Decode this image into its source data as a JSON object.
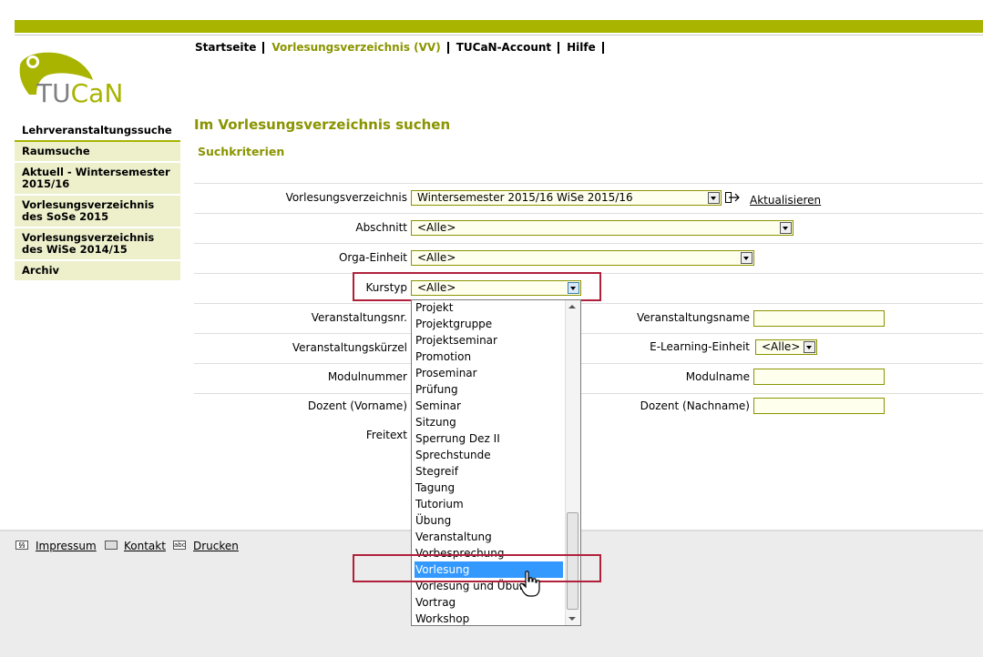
{
  "logo": {
    "text_a": "TU",
    "text_b": "CaN"
  },
  "nav": [
    {
      "label": "Startseite",
      "active": false
    },
    {
      "label": "Vorlesungsverzeichnis (VV)",
      "active": true
    },
    {
      "label": "TUCaN-Account",
      "active": false
    },
    {
      "label": "Hilfe",
      "active": false
    }
  ],
  "sidebar": [
    {
      "label": "Lehrveranstaltungssuche"
    },
    {
      "label": "Raumsuche"
    },
    {
      "label": "Aktuell - Wintersemester 2015/16"
    },
    {
      "label": "Vorlesungsverzeichnis des SoSe 2015"
    },
    {
      "label": "Vorlesungsverzeichnis des WiSe 2014/15"
    },
    {
      "label": "Archiv"
    }
  ],
  "page": {
    "title": "Im Vorlesungsverzeichnis suchen",
    "subtitle": "Suchkriterien"
  },
  "form": {
    "vv_label": "Vorlesungsverzeichnis",
    "vv_value": "Wintersemester 2015/16 WiSe 2015/16",
    "refresh_label": "Aktualisieren",
    "abschnitt_label": "Abschnitt",
    "abschnitt_value": "<Alle>",
    "orga_label": "Orga-Einheit",
    "orga_value": "<Alle>",
    "kurstyp_label": "Kurstyp",
    "kurstyp_value": "<Alle>",
    "vnr_label": "Veranstaltungsnr.",
    "vname_label": "Veranstaltungsname",
    "vkuerzel_label": "Veranstaltungskürzel",
    "elearning_label": "E-Learning-Einheit",
    "elearning_value": "<Alle>",
    "modulnr_label": "Modulnummer",
    "modulname_label": "Modulname",
    "dozent_vor_label": "Dozent (Vorname)",
    "dozent_nach_label": "Dozent (Nachname)",
    "freitext_label": "Freitext"
  },
  "dropdown": {
    "items": [
      "Projekt",
      "Projektgruppe",
      "Projektseminar",
      "Promotion",
      "Proseminar",
      "Prüfung",
      "Seminar",
      "Sitzung",
      "Sperrung Dez II",
      "Sprechstunde",
      "Stegreif",
      "Tagung",
      "Tutorium",
      "Übung",
      "Veranstaltung",
      "Vorbesprechung",
      "Vorlesung",
      "Vorlesung und Übung",
      "Vortrag",
      "Workshop"
    ],
    "selected_index": 16
  },
  "footer": {
    "impressum": "Impressum",
    "kontakt": "Kontakt",
    "drucken": "Drucken",
    "impressum_icon": "§§",
    "drucken_icon": "abc"
  },
  "colors": {
    "accent": "#a8b400",
    "accent_text": "#8a9400",
    "highlight": "#b0203a",
    "selection": "#3399ff"
  }
}
